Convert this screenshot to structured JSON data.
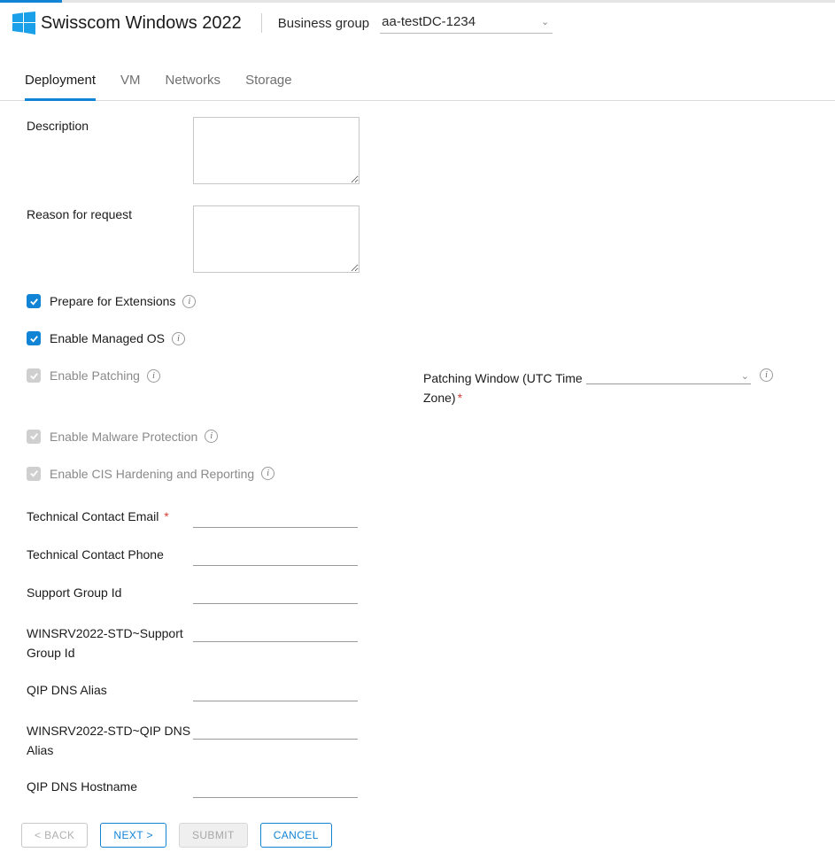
{
  "header": {
    "title": "Swisscom Windows 2022",
    "business_group_label": "Business group",
    "business_group_value": "aa-testDC-1234"
  },
  "tabs": [
    {
      "label": "Deployment",
      "active": true
    },
    {
      "label": "VM",
      "active": false
    },
    {
      "label": "Networks",
      "active": false
    },
    {
      "label": "Storage",
      "active": false
    }
  ],
  "form": {
    "description_label": "Description",
    "description_value": "",
    "reason_label": "Reason for request",
    "reason_value": "",
    "prepare_ext_label": "Prepare for Extensions",
    "enable_managed_os_label": "Enable Managed OS",
    "enable_patching_label": "Enable Patching",
    "patching_window_label": "Patching Window (UTC Time Zone)",
    "enable_malware_label": "Enable Malware Protection",
    "enable_cis_label": "Enable CIS Hardening and Reporting",
    "tech_email_label": "Technical Contact Email",
    "tech_phone_label": "Technical Contact Phone",
    "support_group_label": "Support Group Id",
    "winsrv_support_group_label": "WINSRV2022-STD~Support Group Id",
    "qip_alias_label": "QIP DNS Alias",
    "winsrv_qip_alias_label": "WINSRV2022-STD~QIP DNS Alias",
    "qip_hostname_label": "QIP DNS Hostname"
  },
  "footer": {
    "back": "< BACK",
    "next": "NEXT >",
    "submit": "SUBMIT",
    "cancel": "CANCEL"
  }
}
